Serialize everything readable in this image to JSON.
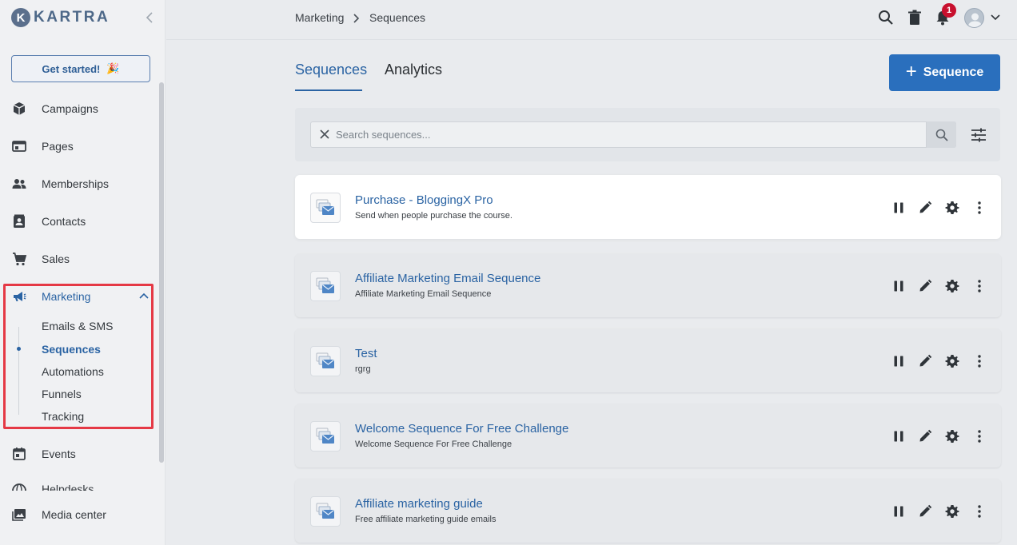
{
  "brand": {
    "logo_letter": "K",
    "name": "KARTRA"
  },
  "sidebar": {
    "get_started": {
      "label": "Get started!",
      "emoji": "🎉"
    },
    "items": [
      {
        "label": "Campaigns",
        "icon": "box-icon"
      },
      {
        "label": "Pages",
        "icon": "browser-icon"
      },
      {
        "label": "Memberships",
        "icon": "people-icon"
      },
      {
        "label": "Contacts",
        "icon": "contact-card-icon"
      },
      {
        "label": "Sales",
        "icon": "cart-icon"
      },
      {
        "label": "Marketing",
        "icon": "megaphone-icon"
      },
      {
        "label": "Events",
        "icon": "calendar-icon"
      },
      {
        "label": "Helpdesks",
        "icon": "globe-icon"
      },
      {
        "label": "Media center",
        "icon": "image-icon"
      }
    ],
    "marketing_sub": [
      "Emails & SMS",
      "Sequences",
      "Automations",
      "Funnels",
      "Tracking"
    ],
    "active_sub": "Sequences"
  },
  "header": {
    "breadcrumb": [
      "Marketing",
      "Sequences"
    ],
    "notification_count": "1"
  },
  "tabs": [
    {
      "label": "Sequences",
      "active": true
    },
    {
      "label": "Analytics",
      "active": false
    }
  ],
  "add_button": {
    "label": "Sequence"
  },
  "search": {
    "placeholder": "Search sequences..."
  },
  "sequences": [
    {
      "title": "Purchase - BloggingX Pro",
      "description": "Send when people purchase the course."
    },
    {
      "title": "Affiliate Marketing Email Sequence",
      "description": "Affiliate Marketing Email Sequence"
    },
    {
      "title": "Test",
      "description": "rgrg"
    },
    {
      "title": "Welcome Sequence For Free Challenge",
      "description": "Welcome Sequence For Free Challenge"
    },
    {
      "title": "Affiliate marketing guide",
      "description": "Free affiliate marketing guide emails"
    }
  ],
  "colors": {
    "accent": "#2a63a3",
    "button": "#2a6fbd",
    "highlight": "#e53945",
    "badge": "#c8102e"
  }
}
